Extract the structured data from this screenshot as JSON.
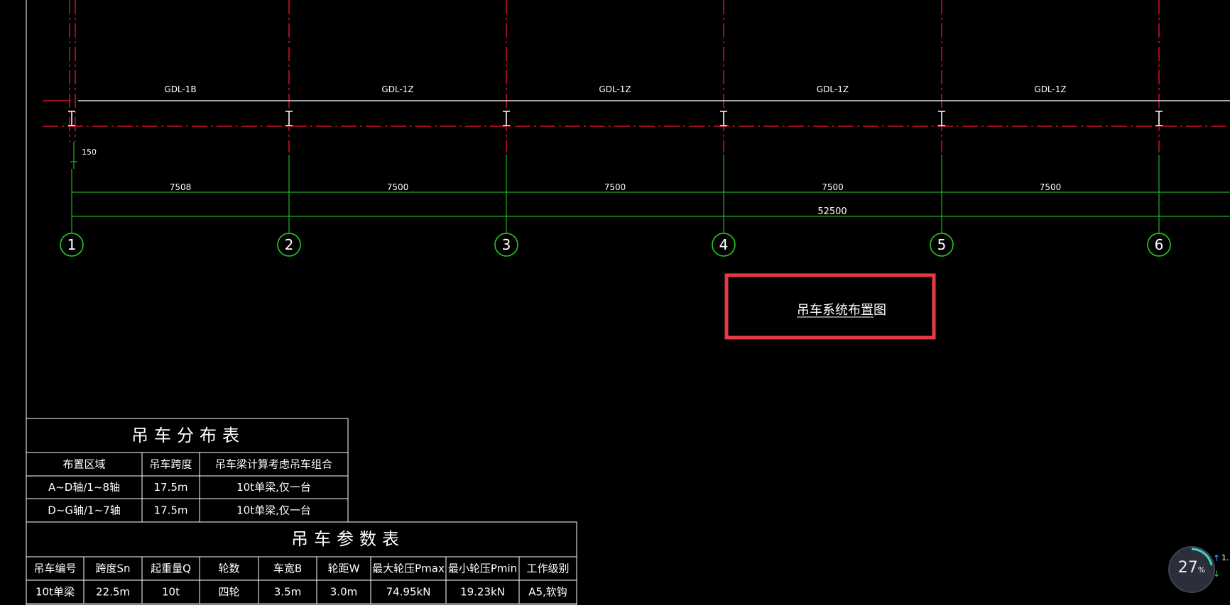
{
  "beam_labels": [
    "GDL-1B",
    "GDL-1Z",
    "GDL-1Z",
    "GDL-1Z",
    "GDL-1Z"
  ],
  "small_dim": "150",
  "span_dims": [
    "7508",
    "7500",
    "7500",
    "7500",
    "7500"
  ],
  "total_dim": "52500",
  "axis_numbers": [
    "1",
    "2",
    "3",
    "4",
    "5",
    "6"
  ],
  "drawing_title": "吊车系统布置图",
  "distribution_table": {
    "title": "吊车分布表",
    "headers": [
      "布置区域",
      "吊车跨度",
      "吊车梁计算考虑吊车组合"
    ],
    "rows": [
      [
        "A~D轴/1~8轴",
        "17.5m",
        "10t单梁,仅一台"
      ],
      [
        "D~G轴/1~7轴",
        "17.5m",
        "10t单梁,仅一台"
      ]
    ]
  },
  "parameter_table": {
    "title": "吊车参数表",
    "headers": [
      "吊车编号",
      "跨度Sn",
      "起重量Q",
      "轮数",
      "车宽B",
      "轮距W",
      "最大轮压Pmax",
      "最小轮压Pmin",
      "工作级别"
    ],
    "rows": [
      [
        "10t单梁",
        "22.5m",
        "10t",
        "四轮",
        "3.5m",
        "3.0m",
        "74.95kN",
        "19.23kN",
        "A5,软钩"
      ]
    ]
  },
  "status": {
    "percent": "27",
    "unit": "%",
    "side_value": "1."
  },
  "colors": {
    "background": "#000000",
    "axis_red": "#d4102a",
    "dim_green": "#27d327",
    "highlight_red": "#e53c44",
    "line_white": "#ffffff"
  }
}
